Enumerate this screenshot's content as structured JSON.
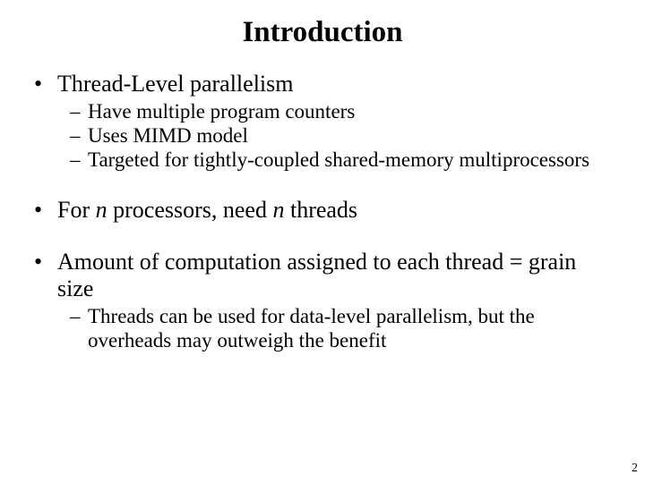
{
  "title": "Introduction",
  "b1": {
    "head": "Thread-Level parallelism",
    "s1": "Have multiple program counters",
    "s2": "Uses MIMD model",
    "s3": "Targeted for tightly-coupled shared-memory multiprocessors"
  },
  "b2": {
    "t1": "For ",
    "n1": "n",
    "t2": " processors, need ",
    "n2": "n",
    "t3": " threads"
  },
  "b3": {
    "head": "Amount of computation assigned to each thread = grain size",
    "s1": "Threads can be used for data-level parallelism, but the overheads may outweigh the benefit"
  },
  "pagenum": "2"
}
